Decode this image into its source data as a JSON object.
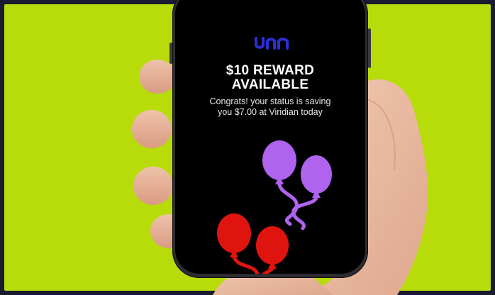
{
  "brand": {
    "logo_icon": "viridian-logo-icon",
    "logo_color": "#2b2fd6"
  },
  "reward": {
    "headline_line1": "$10 REWARD",
    "headline_line2": "AVAILABLE",
    "message": "Congrats! your status is saving you $7.00 at Viridian today"
  },
  "colors": {
    "background": "#b7dc0a",
    "screen": "#000000",
    "balloon_purple": "#b063ee",
    "balloon_red": "#e0140f"
  },
  "icons": [
    "purple-balloons-icon",
    "red-balloons-icon"
  ]
}
